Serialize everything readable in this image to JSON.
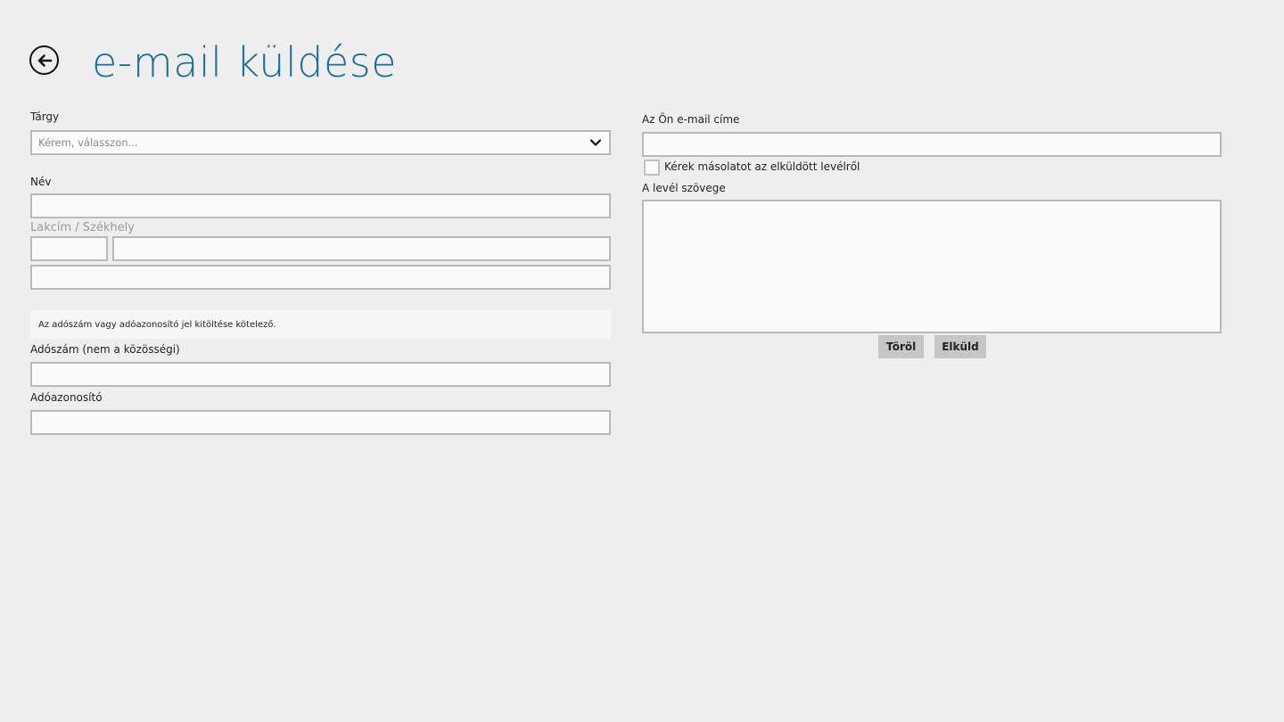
{
  "header": {
    "title": "e-mail küldése"
  },
  "left": {
    "subject_label": "Tárgy",
    "subject_placeholder": "Kérem, válasszon...",
    "name_label": "Név",
    "address_label": "Lakcím / Székhely",
    "notice": "Az adószám vagy adóazonosító jel kitöltése kötelező.",
    "tax_number_label": "Adószám (nem a közösségi)",
    "tax_id_label": "Adóazonosító"
  },
  "right": {
    "email_label": "Az Ön e-mail címe",
    "copy_checkbox_label": "Kérek másolatot az elküldött levélről",
    "message_label": "A levél szövege"
  },
  "buttons": {
    "clear": "Töröl",
    "send": "Elküld"
  },
  "colors": {
    "title": "#1e6f96",
    "background": "#eeeeee",
    "button": "#c6c6c6"
  }
}
